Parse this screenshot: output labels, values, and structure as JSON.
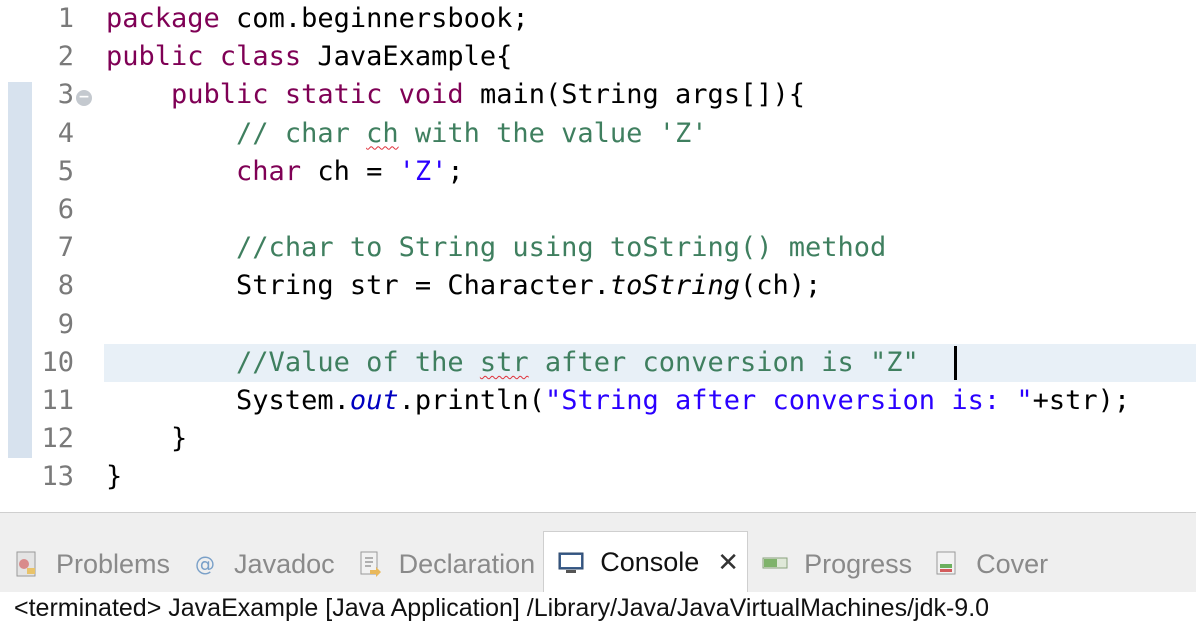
{
  "editor": {
    "line_numbers": [
      "1",
      "2",
      "3",
      "4",
      "5",
      "6",
      "7",
      "8",
      "9",
      "10",
      "11",
      "12",
      "13"
    ],
    "lines": [
      [
        {
          "t": "package",
          "c": "kw"
        },
        {
          "t": " com.beginnersbook;"
        }
      ],
      [
        {
          "t": "public",
          "c": "kw"
        },
        {
          "t": " "
        },
        {
          "t": "class",
          "c": "kw"
        },
        {
          "t": " JavaExample{"
        }
      ],
      [
        {
          "t": "    "
        },
        {
          "t": "public",
          "c": "kw"
        },
        {
          "t": " "
        },
        {
          "t": "static",
          "c": "kw"
        },
        {
          "t": " "
        },
        {
          "t": "void",
          "c": "kw"
        },
        {
          "t": " main(String args[]){"
        }
      ],
      [
        {
          "t": "        "
        },
        {
          "t": "// char ",
          "c": "cm"
        },
        {
          "t": "ch",
          "c": "cm squig"
        },
        {
          "t": " with the value 'Z'",
          "c": "cm"
        }
      ],
      [
        {
          "t": "        "
        },
        {
          "t": "char",
          "c": "kw"
        },
        {
          "t": " ch = "
        },
        {
          "t": "'Z'",
          "c": "str"
        },
        {
          "t": ";"
        }
      ],
      [],
      [
        {
          "t": "        "
        },
        {
          "t": "//char to String using toString() method",
          "c": "cm"
        }
      ],
      [
        {
          "t": "        String str = Character."
        },
        {
          "t": "toString",
          "c": "it"
        },
        {
          "t": "(ch);"
        }
      ],
      [],
      [
        {
          "t": "        "
        },
        {
          "t": "//Value of the ",
          "c": "cm"
        },
        {
          "t": "str",
          "c": "cm squig"
        },
        {
          "t": " after conversion is \"Z\"",
          "c": "cm"
        }
      ],
      [
        {
          "t": "        System."
        },
        {
          "t": "out",
          "c": "fld"
        },
        {
          "t": ".println("
        },
        {
          "t": "\"String after conversion is: \"",
          "c": "str"
        },
        {
          "t": "+str);"
        }
      ],
      [
        {
          "t": "    }"
        }
      ],
      [
        {
          "t": "}"
        }
      ]
    ]
  },
  "tabs": [
    {
      "name": "tab-problems",
      "icon": "problems-icon",
      "label": "Problems"
    },
    {
      "name": "tab-javadoc",
      "icon": "javadoc-icon",
      "label": "Javadoc"
    },
    {
      "name": "tab-declaration",
      "icon": "declaration-icon",
      "label": "Declaration"
    },
    {
      "name": "tab-console",
      "icon": "console-icon",
      "label": "Console",
      "active": true
    },
    {
      "name": "tab-progress",
      "icon": "progress-icon",
      "label": "Progress"
    },
    {
      "name": "tab-coverage",
      "icon": "coverage-icon",
      "label": "Cover"
    }
  ],
  "console": {
    "status_line": "<terminated> JavaExample [Java Application] /Library/Java/JavaVirtualMachines/jdk-9.0"
  }
}
